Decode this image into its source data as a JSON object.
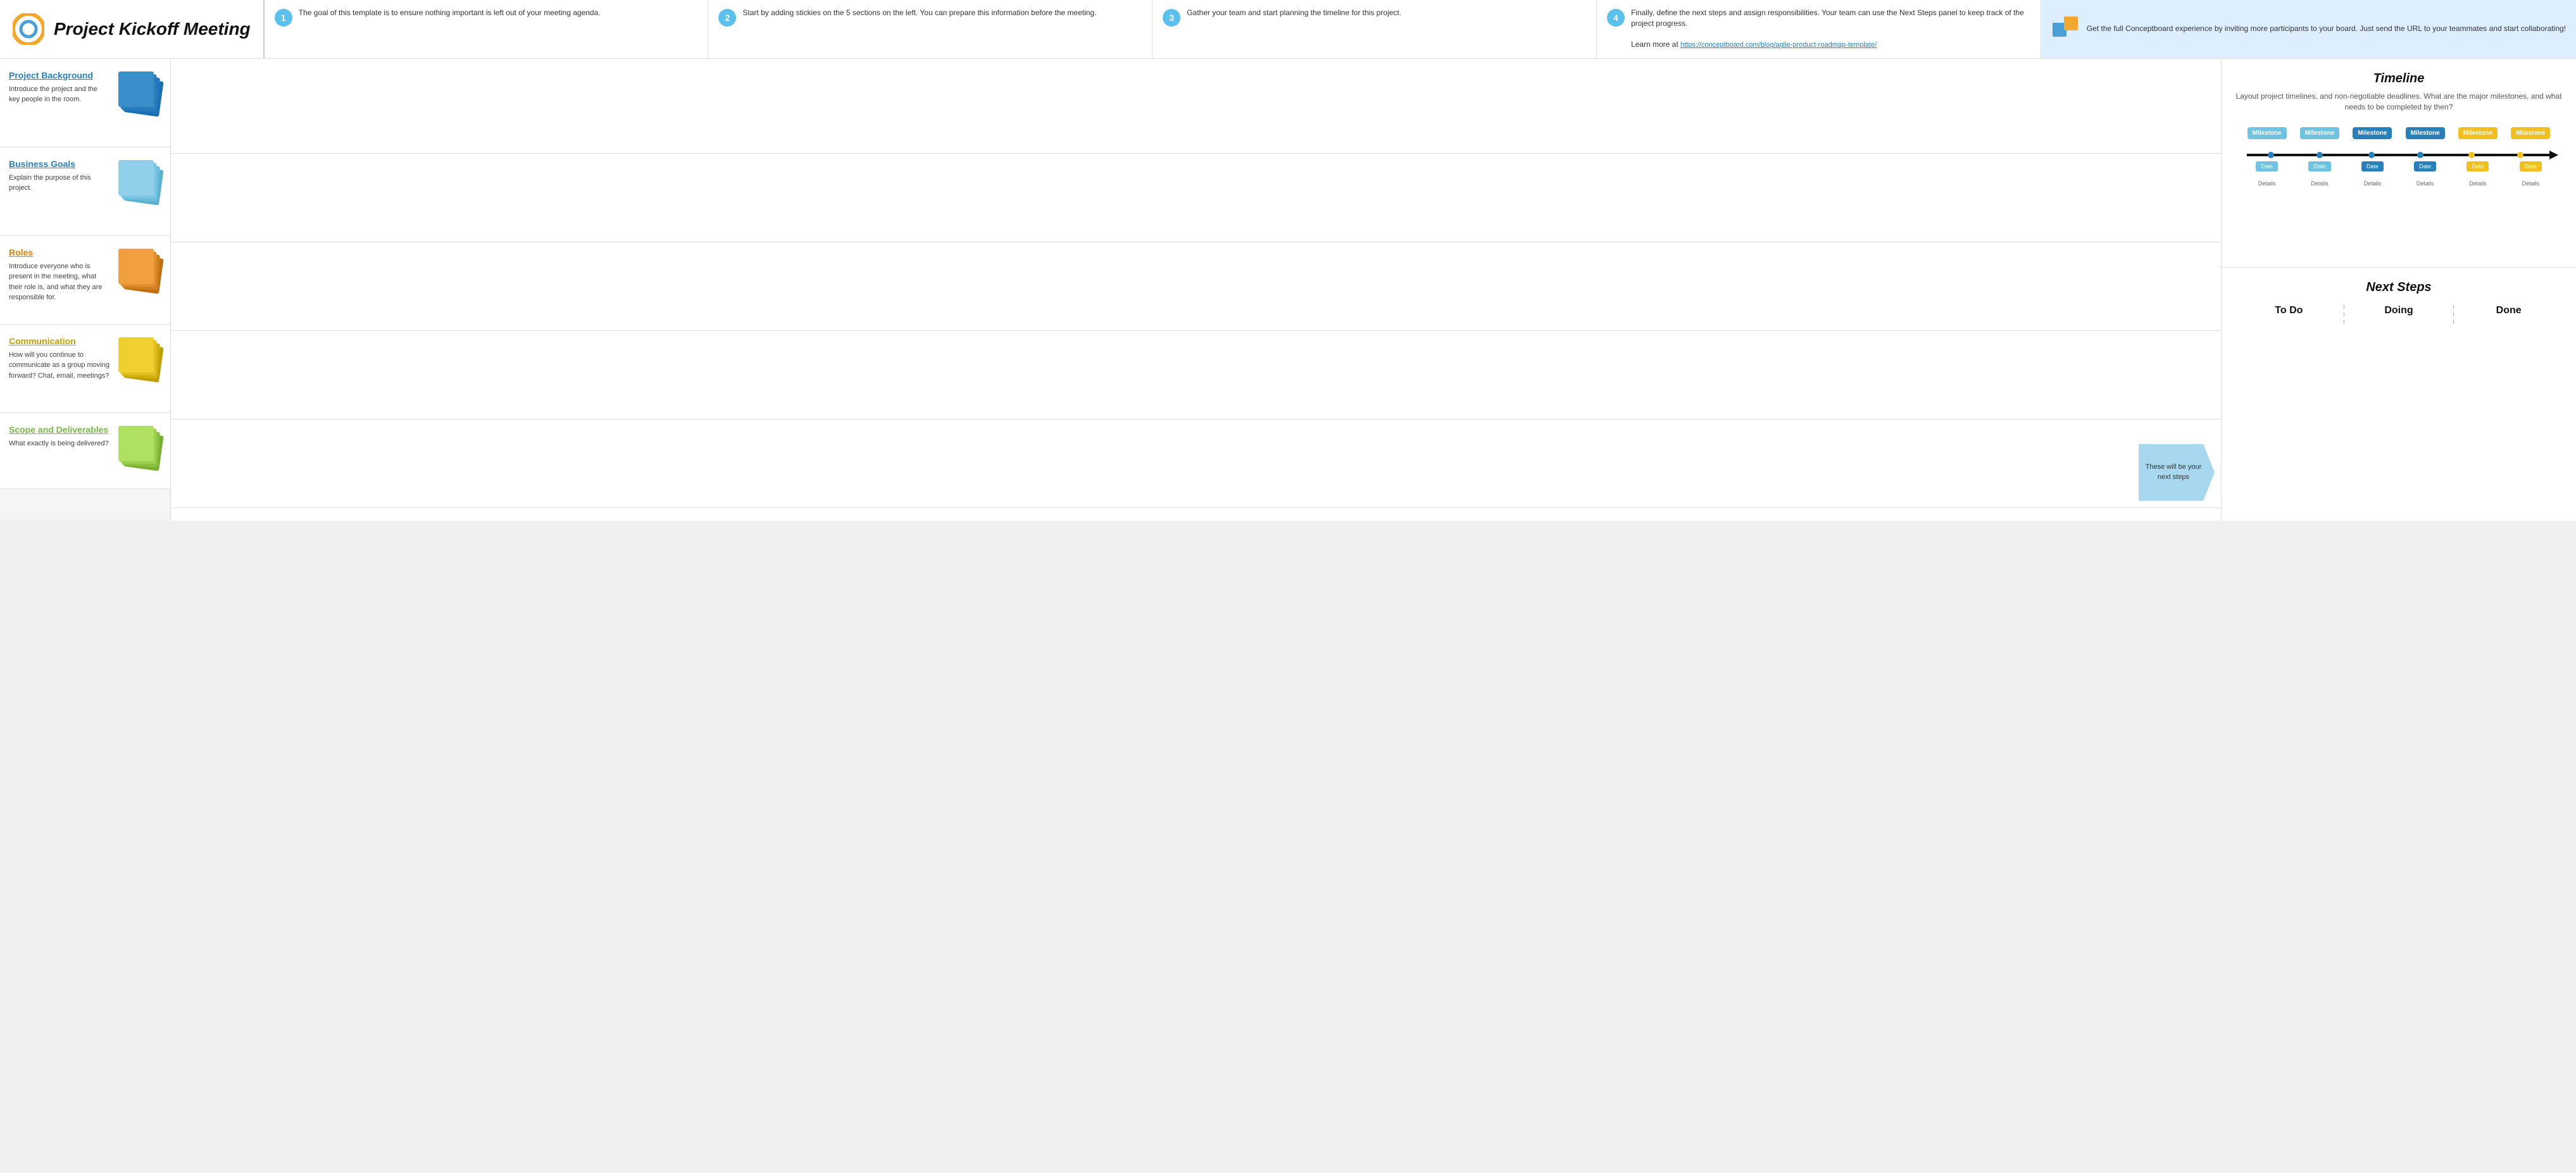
{
  "header": {
    "title": "Project Kickoff Meeting",
    "logo_color1": "#f0a830",
    "logo_color2": "#4a9fd4",
    "steps": [
      {
        "number": "1",
        "text": "The goal of this template is to ensure nothing important is left out of your meeting agenda."
      },
      {
        "number": "2",
        "text": "Start by adding stickies on the 5 sections on the left. You can prepare this information before the meeting."
      },
      {
        "number": "3",
        "text": "Gather your team and start planning the timeline for this project."
      },
      {
        "number": "4",
        "text": "Finally, define the next steps and assign responsibilities. Your team can use the Next Steps panel to keep track of the project progress.\n\nLearn more at https://conceptboard.com/blog/agile-product-roadmap-template/"
      }
    ],
    "cta": {
      "text": "Get the full Conceptboard experience by inviting more participants to your board. Just send the URL to your teammates and start collaborating!"
    }
  },
  "sidebar": {
    "sections": [
      {
        "id": "project-background",
        "title": "Project Background",
        "desc": "Introduce the project and the key people in the room.",
        "note_color": "#2980b9",
        "title_class": "blue"
      },
      {
        "id": "business-goals",
        "title": "Business Goals",
        "desc": "Explain the purpose of this project.",
        "note_color": "#7ec8e3",
        "title_class": "blue"
      },
      {
        "id": "roles",
        "title": "Roles",
        "desc": "Introduce everyone who is present in the meeting, what their role is, and what they are responsible for.",
        "note_color": "#f0a030",
        "title_class": "orange"
      },
      {
        "id": "communication",
        "title": "Communication",
        "desc": "How will you continue to communicate as a group moving forward? Chat, email, meetings?",
        "note_color": "#f0d020",
        "title_class": "yellow"
      },
      {
        "id": "scope-deliverables",
        "title": "Scope and Deliverables",
        "desc": "What exactly is being delivered?",
        "note_color": "#b8e068",
        "title_class": "green"
      }
    ]
  },
  "timeline": {
    "title": "Timeline",
    "subtitle": "Layout project timelines, and non-negotiable deadlines. What are the major milestones, and what needs to be completed by then?",
    "milestones": [
      {
        "label": "Milestone",
        "color": "blue-light",
        "date": "Date",
        "details": "Details"
      },
      {
        "label": "Milestone",
        "color": "blue-light",
        "date": "Date",
        "details": "Details"
      },
      {
        "label": "Milestone",
        "color": "blue-dark",
        "date": "Date",
        "details": "Details"
      },
      {
        "label": "Milestone",
        "color": "blue-dark",
        "date": "Date",
        "details": "Details"
      },
      {
        "label": "Milestone",
        "color": "yellow",
        "date": "Date",
        "details": "Details"
      },
      {
        "label": "Milestone",
        "color": "yellow",
        "date": "Date",
        "details": "Details"
      }
    ]
  },
  "next_steps": {
    "title": "Next Steps",
    "columns": [
      {
        "id": "todo",
        "title": "To Do"
      },
      {
        "id": "doing",
        "title": "Doing"
      },
      {
        "id": "done",
        "title": "Done"
      }
    ],
    "arrow_text": "These will be your next steps"
  }
}
